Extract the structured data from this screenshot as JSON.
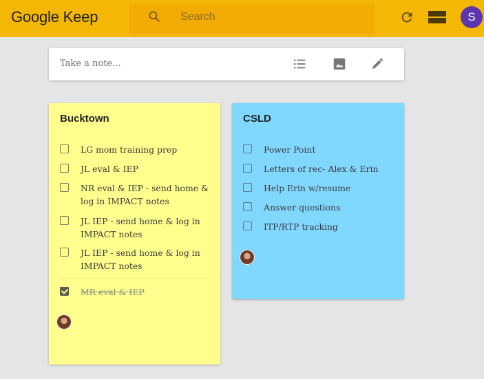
{
  "app": {
    "logo": "Google Keep"
  },
  "header": {
    "search_placeholder": "Search",
    "avatar_initial": "S",
    "colors": {
      "bar": "#f5b705",
      "avatar": "#5e35b1"
    },
    "icons": [
      "search-icon",
      "refresh-icon",
      "list-view-icon"
    ]
  },
  "take_note": {
    "placeholder": "Take a note...",
    "icons": [
      "checklist-icon",
      "image-icon",
      "drawing-icon"
    ]
  },
  "notes": [
    {
      "title": "Bucktown",
      "color": "#ffff8d",
      "items": [
        {
          "text": "LG mom training prep",
          "checked": false
        },
        {
          "text": "JL eval & IEP",
          "checked": false
        },
        {
          "text": "NR eval & IEP - send home & log in IMPACT notes",
          "checked": false
        },
        {
          "text": "JL IEP - send home & log in IMPACT notes",
          "checked": false
        },
        {
          "text": "JL IEP - send home & log in IMPACT notes",
          "checked": false
        }
      ],
      "completed_items": [
        {
          "text": "MR eval & IEP",
          "checked": true
        }
      ]
    },
    {
      "title": "CSLD",
      "color": "#80d8ff",
      "items": [
        {
          "text": "Power Point",
          "checked": false
        },
        {
          "text": "Letters of rec- Alex & Erin",
          "checked": false
        },
        {
          "text": "Help Erin w/resume",
          "checked": false
        },
        {
          "text": "Answer questions",
          "checked": false
        },
        {
          "text": "ITP/RTP tracking",
          "checked": false
        }
      ]
    }
  ]
}
